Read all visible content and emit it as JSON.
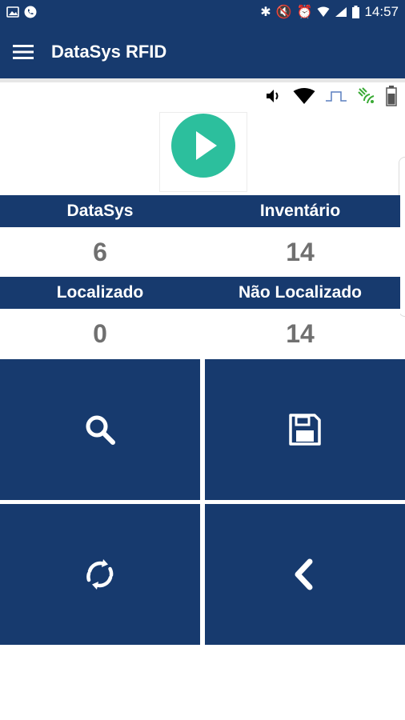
{
  "status_bar": {
    "time": "14:57"
  },
  "app_bar": {
    "title": "DataSys RFID"
  },
  "stats": {
    "row1": {
      "left_label": "DataSys",
      "right_label": "Inventário",
      "left_value": "6",
      "right_value": "14"
    },
    "row2": {
      "left_label": "Localizado",
      "right_label": "Não Localizado",
      "left_value": "0",
      "right_value": "14"
    }
  },
  "colors": {
    "primary": "#173a6e",
    "play": "#2cbf9d",
    "value_text": "#707070"
  },
  "icons": {
    "menu": "menu-icon",
    "play": "play-icon",
    "search": "search-icon",
    "save": "save-icon",
    "refresh": "refresh-icon",
    "back": "chevron-left-icon",
    "volume": "volume-icon",
    "wifi": "wifi-icon",
    "trigger": "trigger-icon",
    "rfid_signal": "rfid-signal-icon",
    "battery": "battery-icon"
  }
}
